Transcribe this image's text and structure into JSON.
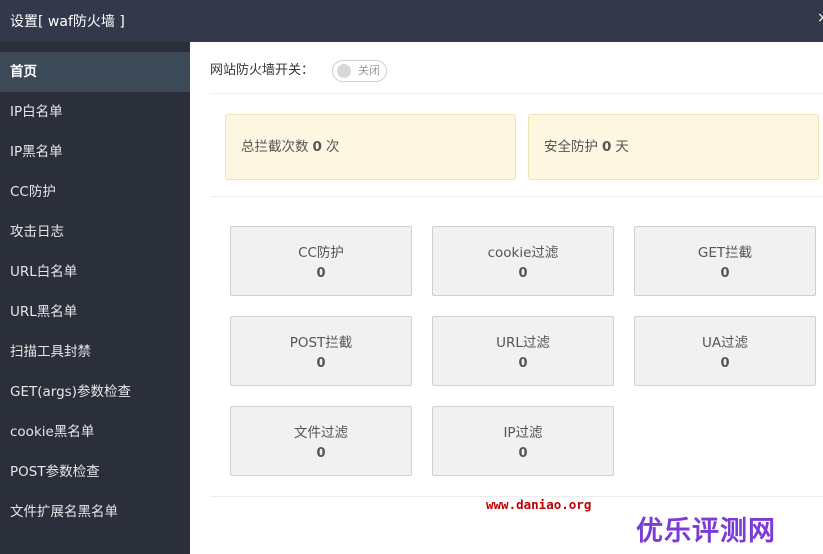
{
  "window": {
    "title": "设置[ waf防火墙 ]",
    "close_glyph": "×"
  },
  "sidebar": {
    "items": [
      {
        "label": "首页",
        "active": true
      },
      {
        "label": "IP白名单"
      },
      {
        "label": "IP黑名单"
      },
      {
        "label": "CC防护"
      },
      {
        "label": "攻击日志"
      },
      {
        "label": "URL白名单"
      },
      {
        "label": "URL黑名单"
      },
      {
        "label": "扫描工具封禁"
      },
      {
        "label": "GET(args)参数检查"
      },
      {
        "label": "cookie黑名单"
      },
      {
        "label": "POST参数检查"
      },
      {
        "label": "文件扩展名黑名单"
      }
    ]
  },
  "main": {
    "switch_label": "网站防火墙开关：",
    "switch_state": "关闭",
    "stats": [
      {
        "prefix": "总拦截次数",
        "value": "0",
        "unit": "次"
      },
      {
        "prefix": "安全防护",
        "value": "0",
        "unit": "天"
      }
    ],
    "cards": [
      {
        "name": "CC防护",
        "value": "0"
      },
      {
        "name": "cookie过滤",
        "value": "0"
      },
      {
        "name": "GET拦截",
        "value": "0"
      },
      {
        "name": "POST拦截",
        "value": "0"
      },
      {
        "name": "URL过滤",
        "value": "0"
      },
      {
        "name": "UA过滤",
        "value": "0"
      },
      {
        "name": "文件过滤",
        "value": "0"
      },
      {
        "name": "IP过滤",
        "value": "0"
      }
    ]
  },
  "watermark": {
    "url": "www.daniao.org",
    "logo": "优乐评测网"
  },
  "colors": {
    "titlebar_bg": "#33394a",
    "sidebar_bg": "#2b2f3a",
    "sidebar_active_bg": "#3c4a57",
    "stat_bg": "#fdf7e1",
    "card_bg": "#f1f1f1",
    "watermark_url": "#c00000",
    "watermark_logo": "#7d3bd6"
  }
}
